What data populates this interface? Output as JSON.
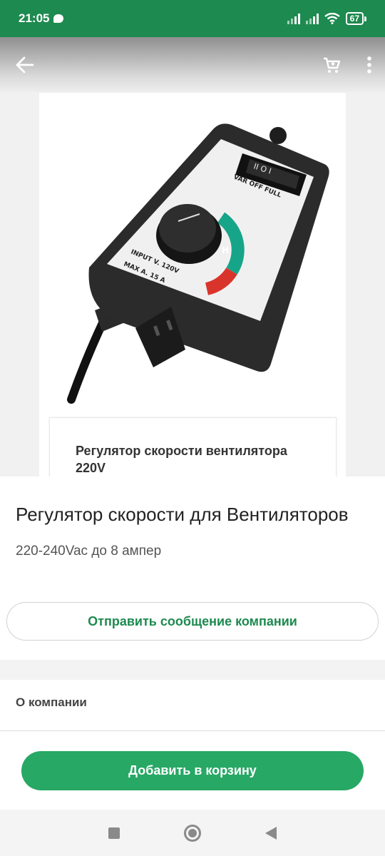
{
  "status_bar": {
    "time": "21:05",
    "battery": "67"
  },
  "header": {
    "back_icon": "arrow-left-icon",
    "cart_icon": "cart-icon",
    "menu_icon": "more-vertical-icon"
  },
  "gallery": {
    "caption": "Регулятор скорости вентилятора 220V"
  },
  "device": {
    "switch_label": "VAR OFF FULL",
    "dial_letter": "H",
    "input_line": "INPUT  V.  120V",
    "max_line": "MAX  A.  15 A"
  },
  "product": {
    "title": "Регулятор скорости для Вентиляторов",
    "subtitle": "220-240Vac до 8 ампер"
  },
  "actions": {
    "message_button": "Отправить сообщение компании",
    "cart_button": "Добавить в корзину"
  },
  "sections": {
    "about_label": "О компании"
  }
}
